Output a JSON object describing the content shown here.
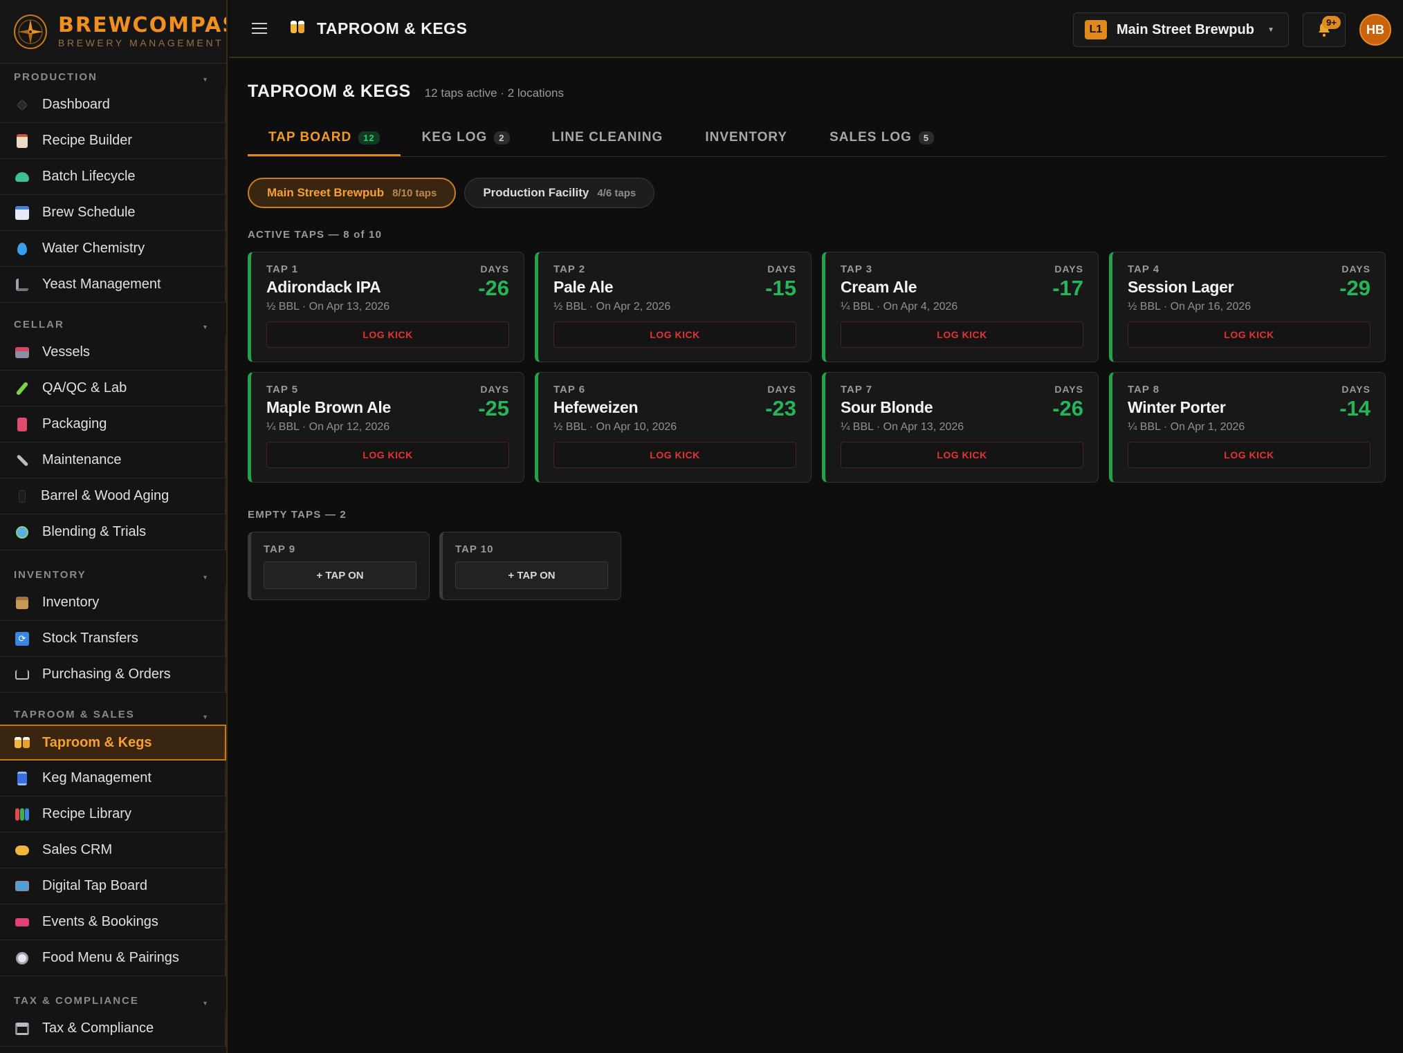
{
  "brand": {
    "name": "BREWCOMPASS",
    "subtitle": "BREWERY MANAGEMENT"
  },
  "sidebar": {
    "sections": [
      {
        "title": "PRODUCTION",
        "items": [
          {
            "label": "Dashboard",
            "icon": "diamond-icon"
          },
          {
            "label": "Recipe Builder",
            "icon": "clipboard-icon"
          },
          {
            "label": "Batch Lifecycle",
            "icon": "flask-icon"
          },
          {
            "label": "Brew Schedule",
            "icon": "calendar-icon"
          },
          {
            "label": "Water Chemistry",
            "icon": "droplet-icon"
          },
          {
            "label": "Yeast Management",
            "icon": "microscope-icon"
          }
        ]
      },
      {
        "title": "CELLAR",
        "items": [
          {
            "label": "Vessels",
            "icon": "factory-icon"
          },
          {
            "label": "QA/QC & Lab",
            "icon": "test-tube-icon"
          },
          {
            "label": "Packaging",
            "icon": "can-icon"
          },
          {
            "label": "Maintenance",
            "icon": "wrench-icon"
          },
          {
            "label": "Barrel & Wood Aging",
            "icon": "barrel-icon"
          },
          {
            "label": "Blending & Trials",
            "icon": "globe-icon"
          }
        ]
      },
      {
        "title": "INVENTORY",
        "items": [
          {
            "label": "Inventory",
            "icon": "package-icon"
          },
          {
            "label": "Stock Transfers",
            "icon": "transfer-icon"
          },
          {
            "label": "Purchasing & Orders",
            "icon": "cart-icon"
          }
        ]
      },
      {
        "title": "TAPROOM & SALES",
        "items": [
          {
            "label": "Taproom & Kegs",
            "icon": "beer-mugs-icon",
            "active": true
          },
          {
            "label": "Keg Management",
            "icon": "keg-icon"
          },
          {
            "label": "Recipe Library",
            "icon": "books-icon"
          },
          {
            "label": "Sales CRM",
            "icon": "handshake-icon"
          },
          {
            "label": "Digital Tap Board",
            "icon": "tv-icon"
          },
          {
            "label": "Events & Bookings",
            "icon": "ticket-icon"
          },
          {
            "label": "Food Menu & Pairings",
            "icon": "plate-icon"
          }
        ]
      },
      {
        "title": "TAX & COMPLIANCE",
        "items": [
          {
            "label": "Tax & Compliance",
            "icon": "bank-icon"
          }
        ]
      }
    ]
  },
  "topbar": {
    "title": "TAPROOM & KEGS",
    "location_badge": "L1",
    "location_name": "Main Street Brewpub",
    "notif_badge": "9+",
    "avatar_initials": "HB"
  },
  "page": {
    "title": "TAPROOM & KEGS",
    "subtitle": "12 taps active · 2 locations"
  },
  "tabs": [
    {
      "label": "TAP BOARD",
      "count": "12",
      "active": true
    },
    {
      "label": "KEG LOG",
      "count": "2"
    },
    {
      "label": "LINE CLEANING",
      "count": ""
    },
    {
      "label": "INVENTORY",
      "count": ""
    },
    {
      "label": "SALES LOG",
      "count": "5"
    }
  ],
  "locations": [
    {
      "name": "Main Street Brewpub",
      "taps": "8/10 taps",
      "active": true
    },
    {
      "name": "Production Facility",
      "taps": "4/6 taps"
    }
  ],
  "active_header": "ACTIVE TAPS — 8 of 10",
  "days_label": "DAYS",
  "kick_label": "LOG KICK",
  "active_taps": [
    {
      "tap": "TAP 1",
      "beer": "Adirondack IPA",
      "meta": "½ BBL · On Apr 13, 2026",
      "days": "-26"
    },
    {
      "tap": "TAP 2",
      "beer": "Pale Ale",
      "meta": "½ BBL · On Apr 2, 2026",
      "days": "-15"
    },
    {
      "tap": "TAP 3",
      "beer": "Cream Ale",
      "meta": "¼ BBL · On Apr 4, 2026",
      "days": "-17"
    },
    {
      "tap": "TAP 4",
      "beer": "Session Lager",
      "meta": "½ BBL · On Apr 16, 2026",
      "days": "-29"
    },
    {
      "tap": "TAP 5",
      "beer": "Maple Brown Ale",
      "meta": "¼ BBL · On Apr 12, 2026",
      "days": "-25"
    },
    {
      "tap": "TAP 6",
      "beer": "Hefeweizen",
      "meta": "½ BBL · On Apr 10, 2026",
      "days": "-23"
    },
    {
      "tap": "TAP 7",
      "beer": "Sour Blonde",
      "meta": "¼ BBL · On Apr 13, 2026",
      "days": "-26"
    },
    {
      "tap": "TAP 8",
      "beer": "Winter Porter",
      "meta": "¼ BBL · On Apr 1, 2026",
      "days": "-14"
    }
  ],
  "empty_header": "EMPTY TAPS — 2",
  "tapon_label": "+ TAP ON",
  "empty_taps": [
    {
      "tap": "TAP 9"
    },
    {
      "tap": "TAP 10"
    }
  ],
  "colors": {
    "accent": "#e08a1c",
    "ok_green": "#27b657",
    "danger_red": "#e23434"
  }
}
